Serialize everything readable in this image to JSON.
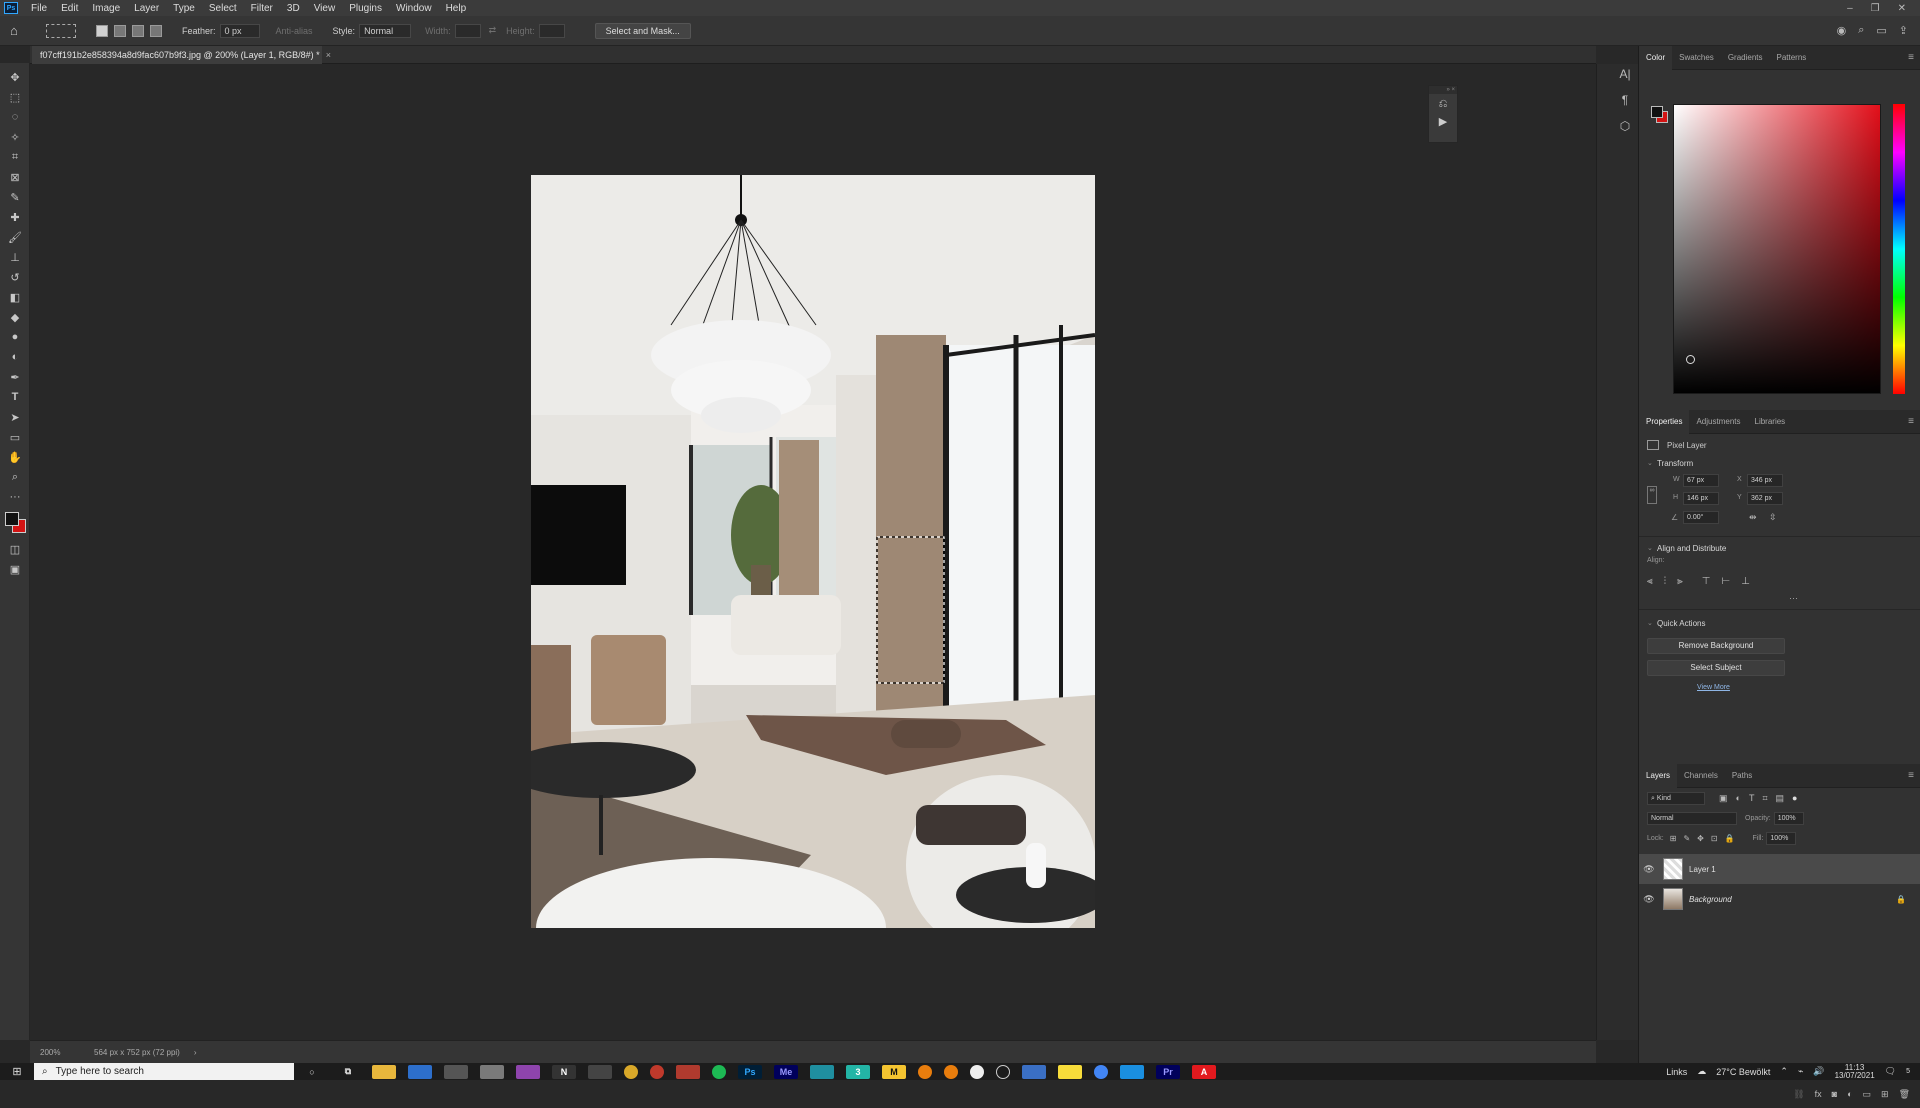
{
  "menubar": {
    "logo": "Ps",
    "items": [
      "File",
      "Edit",
      "Image",
      "Layer",
      "Type",
      "Select",
      "Filter",
      "3D",
      "View",
      "Plugins",
      "Window",
      "Help"
    ],
    "window_controls": [
      "–",
      "❐",
      "✕"
    ]
  },
  "options": {
    "feather_label": "Feather:",
    "feather_value": "0 px",
    "antialias_label": "Anti-alias",
    "style_label": "Style:",
    "style_value": "Normal",
    "width_label": "Width:",
    "height_label": "Height:",
    "select_mask_label": "Select and Mask..."
  },
  "document": {
    "tab_title": "f07cff191b2e858394a8d9fac607b9f3.jpg @ 200% (Layer 1, RGB/8#) *",
    "tab_close": "×"
  },
  "status": {
    "zoom": "200%",
    "doc_info": "564 px x 752 px (72 ppi)"
  },
  "color_panel": {
    "tabs": [
      "Color",
      "Swatches",
      "Gradients",
      "Patterns"
    ],
    "fg_color": "#111111",
    "bg_color": "#d31414"
  },
  "properties_panel": {
    "tabs": [
      "Properties",
      "Adjustments",
      "Libraries"
    ],
    "layer_type": "Pixel Layer",
    "transform_title": "Transform",
    "w_label": "W",
    "w_value": "67 px",
    "x_label": "X",
    "x_value": "346 px",
    "h_label": "H",
    "h_value": "146 px",
    "y_label": "Y",
    "y_value": "362 px",
    "angle_value": "0.00°",
    "align_title": "Align and Distribute",
    "align_label": "Align:",
    "quick_actions_title": "Quick Actions",
    "remove_bg": "Remove Background",
    "select_subject": "Select Subject",
    "view_more": "View More"
  },
  "layers_panel": {
    "tabs": [
      "Layers",
      "Channels",
      "Paths"
    ],
    "kind_label": "Kind",
    "blend_mode": "Normal",
    "opacity_label": "Opacity:",
    "opacity_value": "100%",
    "lock_label": "Lock:",
    "fill_label": "Fill:",
    "fill_value": "100%",
    "layers": [
      {
        "name": "Layer 1",
        "selected": true
      },
      {
        "name": "Background",
        "selected": false
      }
    ]
  },
  "taskbar": {
    "search_placeholder": "Type here to search",
    "links_label": "Links",
    "weather": "27°C Bewölkt",
    "time": "11:13",
    "date": "13/07/2021",
    "notif_count": "5",
    "apps": [
      {
        "label": "Ps",
        "color": "#31a8ff",
        "bg": "#001e36"
      },
      {
        "label": "Me",
        "color": "#9999ff",
        "bg": "#00005b"
      },
      {
        "label": "Pr",
        "color": "#9999ff",
        "bg": "#00005b"
      },
      {
        "label": "A",
        "color": "#ffffff",
        "bg": "#e2191e"
      }
    ]
  }
}
